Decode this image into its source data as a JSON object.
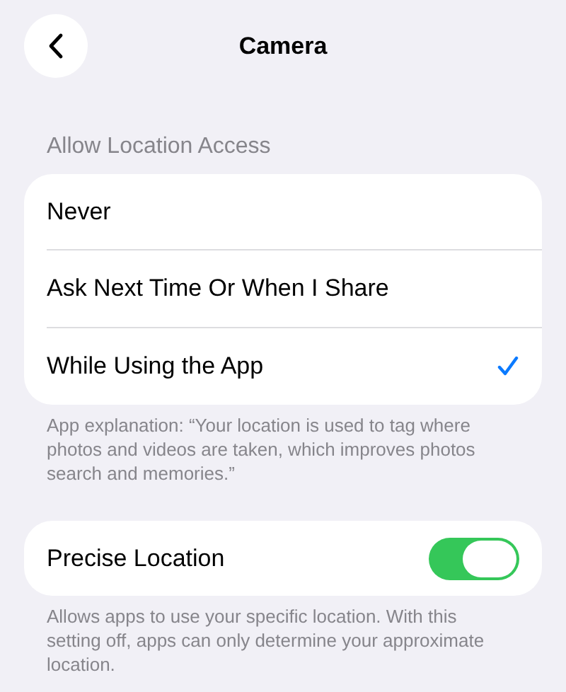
{
  "nav": {
    "title": "Camera"
  },
  "location_access": {
    "header": "Allow Location Access",
    "options": [
      {
        "label": "Never",
        "selected": false
      },
      {
        "label": "Ask Next Time Or When I Share",
        "selected": false
      },
      {
        "label": "While Using the App",
        "selected": true
      }
    ],
    "footer": "App explanation: “Your location is used to tag where photos and videos are taken, which improves photos search and memories.”"
  },
  "precise_location": {
    "label": "Precise Location",
    "on": true,
    "footer": "Allows apps to use your specific location. With this setting off, apps can only determine your approximate location."
  }
}
